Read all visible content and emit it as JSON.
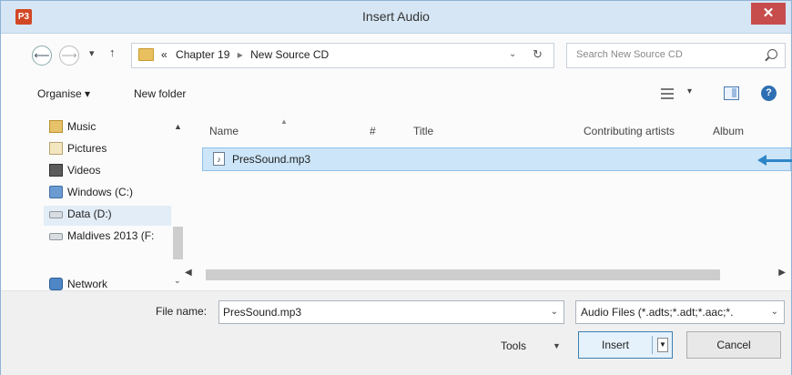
{
  "window": {
    "title": "Insert Audio",
    "app_icon_text": "P3",
    "close_label": "✕"
  },
  "nav": {
    "back_label": "⟵",
    "forward_label": "⟶",
    "history_chevron": "▾",
    "up_label": "↑",
    "breadcrumbs": [
      "«",
      "Chapter 19",
      "New Source CD"
    ],
    "crumb_separator": "▸",
    "address_chevron": "⌄",
    "refresh_label": "↻",
    "search_placeholder": "Search New Source CD"
  },
  "toolbar": {
    "organise_label": "Organise ▾",
    "new_folder_label": "New folder",
    "view_chevron": "▾",
    "help_label": "?"
  },
  "sidebar": {
    "items": [
      {
        "label": "Music",
        "icon": "music-folder-icon"
      },
      {
        "label": "Pictures",
        "icon": "pictures-folder-icon"
      },
      {
        "label": "Videos",
        "icon": "videos-folder-icon"
      },
      {
        "label": "Windows (C:)",
        "icon": "drive-icon"
      },
      {
        "label": "Data (D:)",
        "icon": "external-drive-icon"
      },
      {
        "label": "Maldives 2013 (F:",
        "icon": "external-drive-icon"
      }
    ],
    "network_label": "Network",
    "network_expand": "⌄"
  },
  "columns": {
    "name": "Name",
    "number": "#",
    "title": "Title",
    "artists": "Contributing artists",
    "album": "Album"
  },
  "files": [
    {
      "name": "PresSound.mp3",
      "icon": "audio-file-icon"
    }
  ],
  "bottom": {
    "file_name_label": "File name:",
    "file_name_value": "PresSound.mp3",
    "file_type_value": "Audio Files (*.adts;*.adt;*.aac;*.",
    "tools_label": "Tools",
    "insert_label": "Insert",
    "cancel_label": "Cancel"
  },
  "colors": {
    "accent": "#2e86c8",
    "selection": "#cce5f8",
    "titlebar": "#d6e6f4",
    "close": "#c74d4d"
  }
}
